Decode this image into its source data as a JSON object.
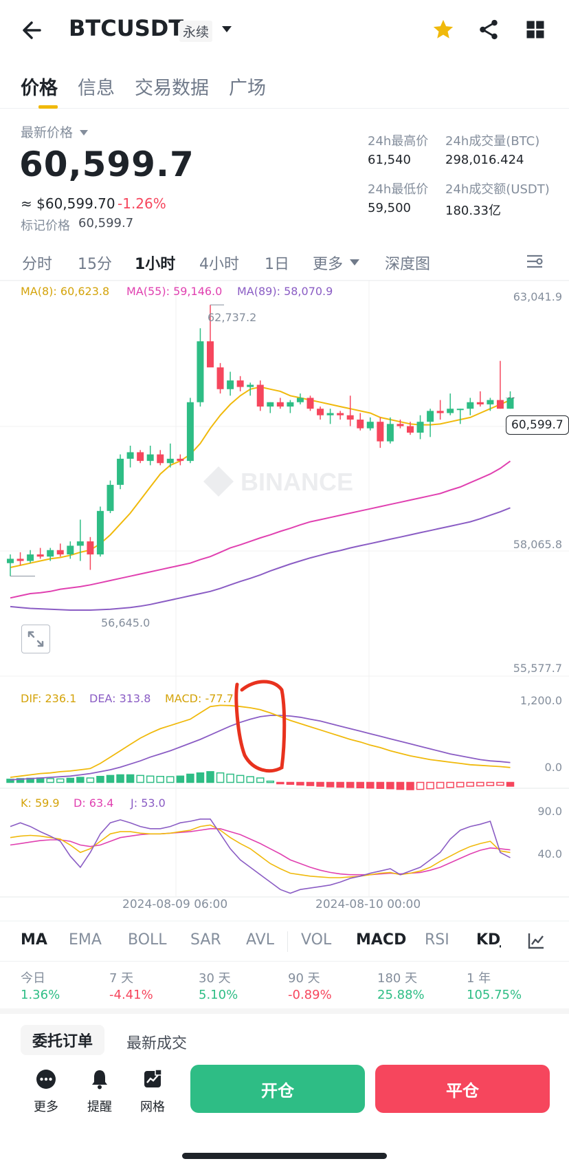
{
  "header": {
    "symbol": "BTCUSDT",
    "contract_type": "永续"
  },
  "tabs": [
    "价格",
    "信息",
    "交易数据",
    "广场"
  ],
  "price": {
    "label": "最新价格",
    "last": "60,599.7",
    "usd": "≈ $60,599.70",
    "change": "-1.26%",
    "mark_label": "标记价格",
    "mark_value": "60,599.7"
  },
  "stats": {
    "high_label": "24h最高价",
    "high": "61,540",
    "vol_btc_label": "24h成交量(BTC)",
    "vol_btc": "298,016.424",
    "low_label": "24h最低价",
    "low": "59,500",
    "vol_usdt_label": "24h成交额(USDT)",
    "vol_usdt": "180.33亿"
  },
  "timeframes": [
    "分时",
    "15分",
    "1小时",
    "4小时",
    "1日",
    "更多",
    "深度图"
  ],
  "active_timeframe": "1小时",
  "ma_legend": {
    "ma8": "MA(8): 60,623.8",
    "ma55": "MA(55): 59,146.0",
    "ma89": "MA(89): 58,070.9"
  },
  "price_axis": [
    "63,041.9",
    "58,065.8",
    "55,577.7"
  ],
  "current_price_tag": "60,599.7",
  "high_annotation": "62,737.2",
  "low_annotation": "56,645.0",
  "watermark": "BINANCE",
  "macd_legend": {
    "dif": "DIF: 236.1",
    "dea": "DEA: 313.8",
    "macd": "MACD: -77.7"
  },
  "macd_axis": [
    "1,200.0",
    "0.0"
  ],
  "kdj_legend": {
    "k": "K: 59.9",
    "d": "D: 63.4",
    "j": "J: 53.0"
  },
  "kdj_axis": [
    "90.0",
    "40.0"
  ],
  "time_axis": [
    "2024-08-09 06:00",
    "2024-08-10 00:00"
  ],
  "indicators": [
    "MA",
    "EMA",
    "BOLL",
    "SAR",
    "AVL",
    "VOL",
    "MACD",
    "RSI",
    "KDJ"
  ],
  "performance": [
    {
      "label": "今日",
      "value": "1.36%"
    },
    {
      "label": "7 天",
      "value": "-4.41%"
    },
    {
      "label": "30 天",
      "value": "5.10%"
    },
    {
      "label": "90 天",
      "value": "-0.89%"
    },
    {
      "label": "180 天",
      "value": "25.88%"
    },
    {
      "label": "1 年",
      "value": "105.75%"
    }
  ],
  "order_tabs": [
    "委托订单",
    "最新成交"
  ],
  "bottom_nav": [
    "更多",
    "提醒",
    "网格"
  ],
  "actions": {
    "open": "开仓",
    "close": "平仓"
  },
  "colors": {
    "up": "#2ebd85",
    "down": "#f6465d",
    "ma8": "#f0b90b",
    "ma55": "#e040b0",
    "ma89": "#8a5cc4",
    "brand": "#f0b90b"
  },
  "chart_data": {
    "type": "candlestick",
    "candles": [
      [
        56800,
        57000,
        56500,
        56900
      ],
      [
        56900,
        57050,
        56750,
        56850
      ],
      [
        56850,
        57100,
        56800,
        57000
      ],
      [
        57000,
        57150,
        56900,
        56950
      ],
      [
        56950,
        57150,
        56850,
        57100
      ],
      [
        57100,
        57250,
        56950,
        57000
      ],
      [
        57000,
        57300,
        56900,
        57200
      ],
      [
        57200,
        57800,
        56850,
        57300
      ],
      [
        57300,
        57400,
        56645,
        57000
      ],
      [
        57000,
        58100,
        56950,
        58000
      ],
      [
        58000,
        58700,
        57950,
        58600
      ],
      [
        58600,
        59300,
        58500,
        59200
      ],
      [
        59200,
        59500,
        59000,
        59350
      ],
      [
        59350,
        59400,
        59100,
        59150
      ],
      [
        59150,
        59500,
        59050,
        59300
      ],
      [
        59300,
        59400,
        59050,
        59100
      ],
      [
        59100,
        59550,
        59000,
        59200
      ],
      [
        59200,
        59300,
        59050,
        59150
      ],
      [
        59150,
        60600,
        59100,
        60500
      ],
      [
        60500,
        62200,
        60400,
        61900
      ],
      [
        61900,
        62737.2,
        61750,
        61300
      ],
      [
        61300,
        61400,
        60700,
        60800
      ],
      [
        60800,
        61200,
        60650,
        61000
      ],
      [
        61000,
        61100,
        60750,
        60850
      ],
      [
        60850,
        60950,
        60650,
        60900
      ],
      [
        60900,
        61000,
        60300,
        60400
      ],
      [
        60400,
        60500,
        60250,
        60500
      ],
      [
        60500,
        60600,
        60350,
        60400
      ],
      [
        60400,
        60550,
        60250,
        60500
      ],
      [
        60500,
        60700,
        60450,
        60600
      ],
      [
        60600,
        60650,
        60300,
        60350
      ],
      [
        60350,
        60400,
        60100,
        60200
      ],
      [
        60200,
        60350,
        60000,
        60250
      ],
      [
        60250,
        60300,
        60100,
        60200
      ],
      [
        60200,
        60650,
        59950,
        60100
      ],
      [
        60100,
        60250,
        59850,
        59900
      ],
      [
        59900,
        60150,
        59850,
        60050
      ],
      [
        60050,
        60150,
        59450,
        59600
      ],
      [
        59600,
        60150,
        59550,
        60000
      ],
      [
        60000,
        60100,
        59900,
        59950
      ],
      [
        59950,
        60050,
        59750,
        59800
      ],
      [
        59800,
        60200,
        59650,
        60050
      ],
      [
        60050,
        60350,
        59700,
        60300
      ],
      [
        60300,
        60550,
        60100,
        60250
      ],
      [
        60250,
        60700,
        60200,
        60350
      ],
      [
        60350,
        60350,
        60000,
        60350
      ],
      [
        60350,
        60600,
        60200,
        60500
      ],
      [
        60500,
        60750,
        60400,
        60450
      ],
      [
        60450,
        60600,
        60300,
        60550
      ],
      [
        60550,
        61450,
        60350,
        60350
      ],
      [
        60350,
        60750,
        60350,
        60599.7
      ]
    ],
    "ma8": [
      56700,
      56750,
      56800,
      56850,
      56900,
      56930,
      56980,
      57050,
      57100,
      57250,
      57450,
      57700,
      57950,
      58250,
      58550,
      58850,
      59050,
      59150,
      59300,
      59550,
      59900,
      60200,
      60450,
      60650,
      60800,
      60850,
      60800,
      60750,
      60650,
      60600,
      60550,
      60500,
      60450,
      60400,
      60350,
      60300,
      60250,
      60150,
      60100,
      60050,
      60000,
      59980,
      59980,
      60000,
      60050,
      60100,
      60150,
      60250,
      60350,
      60450,
      60550
    ],
    "ma55": [
      56000,
      56050,
      56100,
      56120,
      56150,
      56200,
      56230,
      56260,
      56300,
      56350,
      56400,
      56450,
      56500,
      56550,
      56600,
      56650,
      56700,
      56750,
      56800,
      56880,
      56950,
      57050,
      57150,
      57220,
      57300,
      57380,
      57450,
      57530,
      57600,
      57680,
      57750,
      57800,
      57850,
      57900,
      57950,
      58000,
      58050,
      58100,
      58150,
      58200,
      58250,
      58300,
      58350,
      58400,
      58480,
      58550,
      58650,
      58750,
      58850,
      58980,
      59146
    ],
    "ma89": [
      55800,
      55780,
      55760,
      55750,
      55740,
      55730,
      55720,
      55720,
      55720,
      55730,
      55740,
      55760,
      55780,
      55810,
      55850,
      55900,
      55950,
      56000,
      56050,
      56100,
      56150,
      56220,
      56300,
      56380,
      56450,
      56530,
      56620,
      56700,
      56780,
      56850,
      56920,
      56980,
      57040,
      57090,
      57150,
      57200,
      57250,
      57300,
      57350,
      57400,
      57450,
      57500,
      57550,
      57600,
      57650,
      57700,
      57750,
      57820,
      57900,
      57980,
      58070.9
    ],
    "price_range": [
      55577.7,
      63041.9
    ],
    "macd_range": [
      -60,
      1300
    ],
    "kdj_range": [
      0,
      115
    ],
    "macd": {
      "hist": [
        50,
        60,
        65,
        70,
        60,
        55,
        65,
        80,
        70,
        95,
        110,
        120,
        120,
        110,
        100,
        95,
        90,
        100,
        130,
        150,
        170,
        150,
        130,
        110,
        90,
        70,
        20,
        -20,
        -30,
        -40,
        -50,
        -60,
        -70,
        -75,
        -80,
        -85,
        -90,
        -95,
        -100,
        -110,
        -115,
        -110,
        -100,
        -90,
        -80,
        -70,
        -60,
        -55,
        -50,
        -45,
        -60
      ],
      "dif": [
        80,
        100,
        120,
        140,
        150,
        170,
        180,
        200,
        220,
        300,
        400,
        500,
        600,
        700,
        780,
        850,
        900,
        950,
        1000,
        1100,
        1200,
        1220,
        1215,
        1200,
        1180,
        1150,
        1100,
        1040,
        980,
        930,
        880,
        830,
        780,
        730,
        680,
        640,
        590,
        550,
        500,
        460,
        420,
        390,
        360,
        340,
        320,
        300,
        280,
        270,
        260,
        250,
        236.1
      ],
      "dea": [
        40,
        50,
        60,
        70,
        80,
        90,
        100,
        120,
        140,
        170,
        200,
        240,
        290,
        340,
        400,
        450,
        500,
        560,
        620,
        680,
        750,
        820,
        890,
        950,
        1000,
        1040,
        1060,
        1060,
        1050,
        1030,
        1000,
        970,
        930,
        890,
        850,
        810,
        770,
        730,
        690,
        650,
        610,
        570,
        530,
        490,
        450,
        420,
        390,
        360,
        340,
        330,
        313.8
      ]
    },
    "kdj": {
      "k": [
        80,
        82,
        83,
        82,
        80,
        78,
        70,
        60,
        65,
        75,
        85,
        88,
        88,
        86,
        85,
        85,
        86,
        88,
        90,
        95,
        97,
        90,
        80,
        72,
        65,
        55,
        45,
        38,
        32,
        30,
        28,
        27,
        26,
        26,
        27,
        28,
        30,
        32,
        33,
        30,
        32,
        35,
        40,
        48,
        55,
        62,
        68,
        72,
        75,
        62,
        59.9
      ],
      "d": [
        70,
        72,
        74,
        76,
        77,
        77,
        75,
        70,
        68,
        70,
        75,
        80,
        82,
        84,
        85,
        85,
        86,
        87,
        88,
        90,
        92,
        92,
        88,
        84,
        78,
        72,
        65,
        58,
        50,
        45,
        40,
        36,
        33,
        31,
        30,
        30,
        30,
        31,
        32,
        31,
        32,
        33,
        36,
        40,
        46,
        52,
        58,
        63,
        66,
        65,
        63.4
      ],
      "j": [
        95,
        100,
        95,
        88,
        82,
        75,
        55,
        40,
        60,
        85,
        100,
        104,
        100,
        95,
        92,
        92,
        95,
        100,
        102,
        105,
        105,
        85,
        65,
        50,
        40,
        30,
        20,
        10,
        5,
        10,
        12,
        14,
        16,
        20,
        25,
        28,
        32,
        35,
        38,
        30,
        35,
        40,
        50,
        60,
        78,
        90,
        95,
        98,
        102,
        60,
        53.0
      ]
    }
  }
}
